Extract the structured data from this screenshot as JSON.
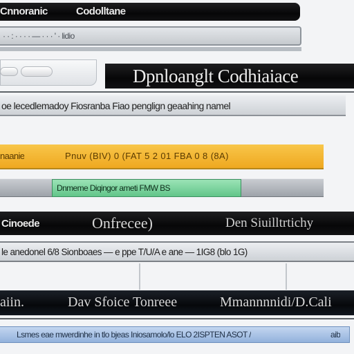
{
  "top_bar": {
    "label_left": "Cnnoranic",
    "label_center": "Codolltane"
  },
  "address_bar": {
    "text": "· · : · · · · — · · · ' · lidio"
  },
  "title_panel": {
    "title": "Dpnloanglt Codhiaiace"
  },
  "status_row_1": {
    "text": "oe lecedlemadoy Fiosranba Fiao penglign geaahing namel"
  },
  "highlight_row": {
    "text_left": "naanie",
    "text_right": "Pnuv   (BIV) 0   (FAT 5 2 01  FBA   0 8   (8A)",
    "color": "#f5b82e"
  },
  "green_chip": {
    "text": "Dnmeme Diqingor ameti  FMW BS",
    "color": "#7fd4a0"
  },
  "second_bar": {
    "label_left": "Cinoede",
    "label_center": "Onfrecee)",
    "label_right": "Den Siuilltrtichy"
  },
  "status_row_2": {
    "text": "le anedonel 6/8 Sionboaes — e ppe  T/U/A  e ane  — 1IG8  (blo 1G)"
  },
  "third_bar": {
    "label_left": "aiin.",
    "label_center": "Dav Sfoice Tonreee",
    "label_right": "Mmannnnidi/D.Cali"
  },
  "bottom_bar": {
    "text": "Lsmes eae  mwerdinhe in tlo bjeas Iniosamolo/lo  ELO  2ISPTEN ASOT /",
    "text_right": "aib",
    "color": "#a9c3e6"
  }
}
